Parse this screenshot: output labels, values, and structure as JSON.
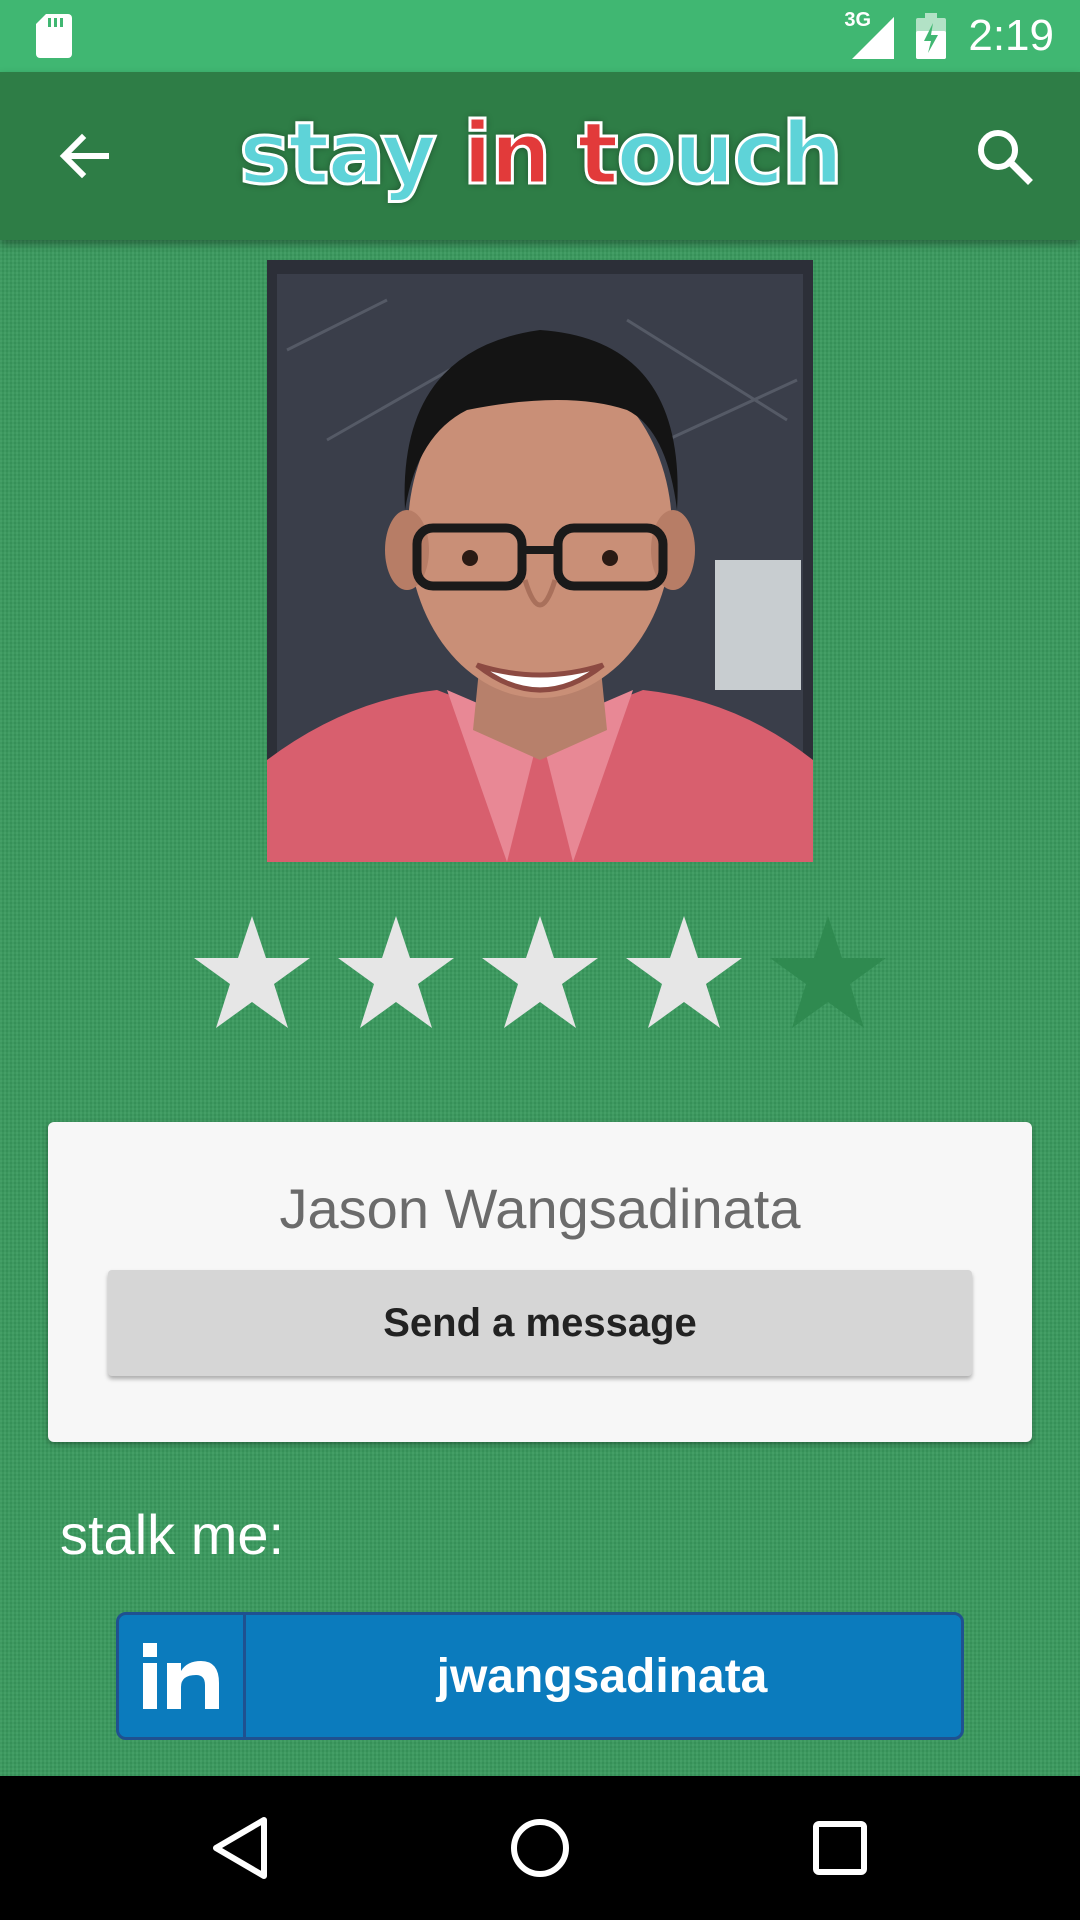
{
  "status_bar": {
    "network": "3G",
    "time": "2:19",
    "icons": [
      "sd-card-icon",
      "signal-icon",
      "battery-charging-icon"
    ]
  },
  "app_bar": {
    "logo_part1": "stay ",
    "logo_part2": "in",
    "logo_part3": " t",
    "logo_part4": "ouch",
    "back_icon": "arrow-back-icon",
    "search_icon": "search-icon"
  },
  "profile": {
    "photo": "profile-photo",
    "rating": 4,
    "rating_max": 5,
    "name": "Jason Wangsadinata",
    "message_button": "Send a message"
  },
  "social": {
    "heading": "stalk me:",
    "linkedin_logo_text": "in",
    "linkedin_username": "jwangsadinata"
  },
  "colors": {
    "status_bar": "#40b772",
    "app_bar": "#2e7d46",
    "background": "#3a9a5e",
    "linkedin_blue": "#0b7bbd",
    "star_filled": "#e6e6e6",
    "star_empty": "#2f8a50"
  },
  "nav_bar": {
    "icons": [
      "nav-back-icon",
      "nav-home-icon",
      "nav-recents-icon"
    ]
  }
}
